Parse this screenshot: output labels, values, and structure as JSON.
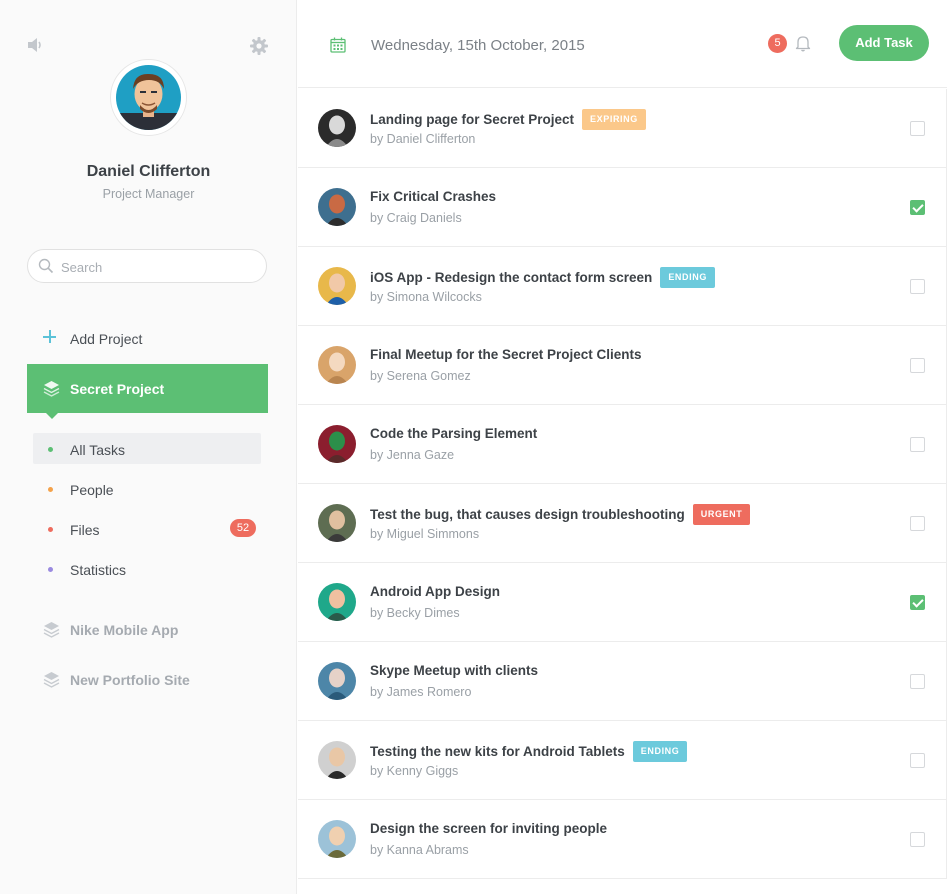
{
  "user": {
    "name": "Daniel Clifferton",
    "role": "Project Manager"
  },
  "search": {
    "placeholder": "Search"
  },
  "sidebar": {
    "add_project_label": "Add Project",
    "active_project": "Secret Project",
    "subnav": [
      {
        "label": "All Tasks",
        "dot_color": "#5cbf74",
        "active": true
      },
      {
        "label": "People",
        "dot_color": "#f4a24a"
      },
      {
        "label": "Files",
        "dot_color": "#ee6c5e",
        "badge": "52"
      },
      {
        "label": "Statistics",
        "dot_color": "#9a8ae0"
      }
    ],
    "projects": [
      "Nike Mobile App",
      "New Portfolio Site"
    ]
  },
  "header": {
    "date": "Wednesday, 15th October, 2015",
    "notifications_count": "5",
    "add_task_label": "Add Task"
  },
  "colors": {
    "accent": "#5cbf74",
    "danger": "#ee6c5e",
    "expiring": "#fbc88a",
    "ending": "#6ccadc"
  },
  "tasks": [
    {
      "title": "Landing page for Secret Project",
      "author": "by Daniel Clifferton",
      "tag": "EXPIRING",
      "tag_color": "#fbc88a",
      "done": false
    },
    {
      "title": "Fix Critical Crashes",
      "author": "by Craig Daniels",
      "tag": "",
      "done": true
    },
    {
      "title": "iOS App - Redesign the contact form screen",
      "author": "by Simona Wilcocks",
      "tag": "ENDING",
      "tag_color": "#6ccadc",
      "done": false
    },
    {
      "title": "Final Meetup for the Secret Project Clients",
      "author": "by Serena Gomez",
      "tag": "",
      "done": false
    },
    {
      "title": "Code the Parsing Element",
      "author": "by Jenna Gaze",
      "tag": "",
      "done": false
    },
    {
      "title": "Test the bug, that causes design troubleshooting",
      "author": "by Miguel Simmons",
      "tag": "URGENT",
      "tag_color": "#ee6c5e",
      "done": false
    },
    {
      "title": "Android App Design",
      "author": "by Becky Dimes",
      "tag": "",
      "done": true
    },
    {
      "title": "Skype Meetup with clients",
      "author": "by James Romero",
      "tag": "",
      "done": false
    },
    {
      "title": "Testing the new kits for Android Tablets",
      "author": "by Kenny Giggs",
      "tag": "ENDING",
      "tag_color": "#6ccadc",
      "done": false
    },
    {
      "title": "Design the screen for inviting people",
      "author": "by Kanna Abrams",
      "tag": "",
      "done": false
    }
  ]
}
